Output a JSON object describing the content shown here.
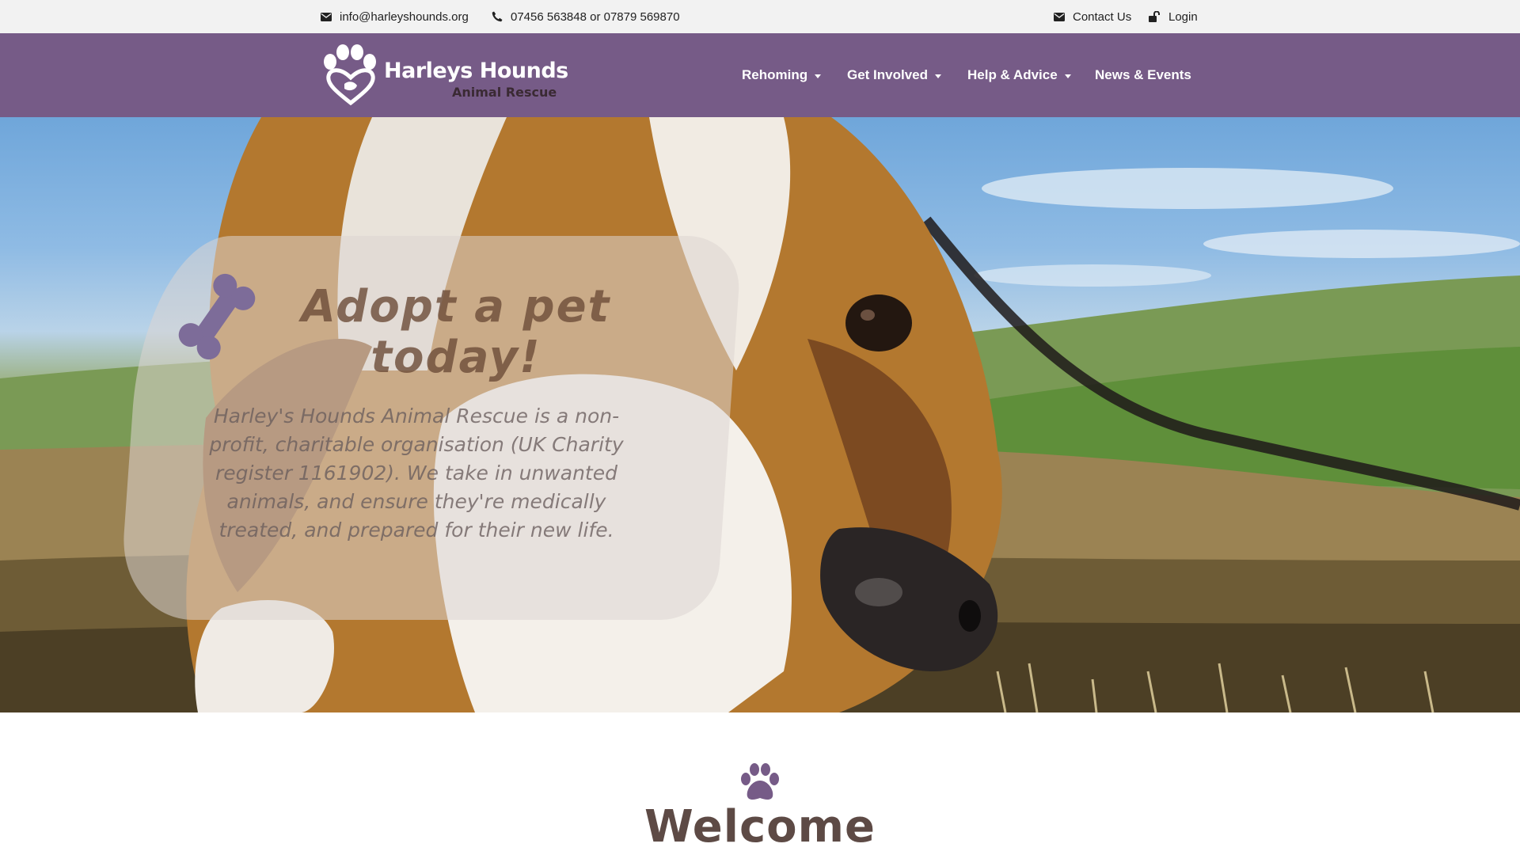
{
  "topbar": {
    "email": "info@harleyshounds.org",
    "phone": "07456 563848 or 07879 569870",
    "contact_label": "Contact Us",
    "login_label": "Login"
  },
  "brand": {
    "name": "Harleys Hounds",
    "tagline": "Animal Rescue"
  },
  "nav": {
    "items": [
      {
        "label": "Rehoming",
        "has_dropdown": true
      },
      {
        "label": "Get Involved",
        "has_dropdown": true
      },
      {
        "label": "Help & Advice",
        "has_dropdown": true
      },
      {
        "label": "News & Events",
        "has_dropdown": false
      }
    ]
  },
  "hero": {
    "title": "Adopt a pet today!",
    "text": "Harley's Hounds Animal Rescue is a non-profit, charitable organisation (UK Charity register 1161902). We take in unwanted animals, and ensure they're medically treated, and prepared for their new life."
  },
  "welcome": {
    "title": "Welcome"
  },
  "icons": {
    "email": "envelope-icon",
    "phone": "phone-icon",
    "contact": "envelope-icon",
    "login": "unlock-icon",
    "hero_decoration": "bone-icon",
    "welcome_decoration": "paw-icon"
  },
  "colors": {
    "brand_purple": "#765b87",
    "topbar_bg": "#f2f2f2",
    "title_brown": "#5d4a45"
  }
}
